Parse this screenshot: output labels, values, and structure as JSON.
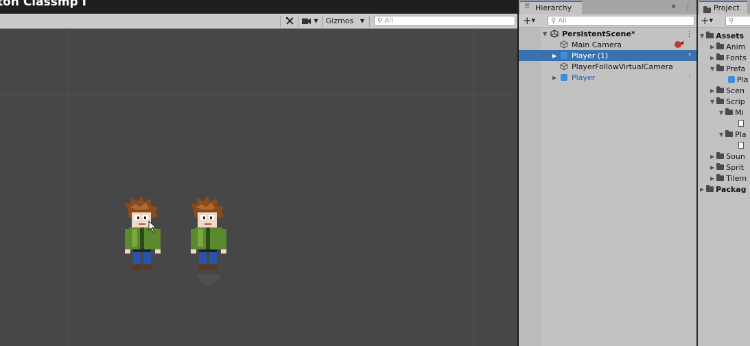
{
  "window": {
    "title": "ton Classmp I"
  },
  "scene_toolbar": {
    "tools_icon": "crossed-tools-icon",
    "camera_icon": "video-camera-icon",
    "gizmos_label": "Gizmos",
    "search_placeholder": "All"
  },
  "hierarchy": {
    "tab_label": "Hierarchy",
    "add_label": "+",
    "search_placeholder": "All",
    "scene_name": "PersistentScene*",
    "items": [
      {
        "label": "Main Camera",
        "icon": "gameobject-outline-icon",
        "selected": false,
        "prefab": false
      },
      {
        "label": "Player (1)",
        "icon": "prefab-cube-icon",
        "selected": true,
        "prefab": true
      },
      {
        "label": "PlayerFollowVirtualCamera",
        "icon": "gameobject-outline-icon",
        "selected": false,
        "prefab": false
      },
      {
        "label": "Player",
        "icon": "prefab-cube-icon",
        "selected": false,
        "prefab": true
      }
    ]
  },
  "project": {
    "tab_label": "Project",
    "add_label": "+",
    "tree": [
      {
        "label": "Assets",
        "bold": true
      },
      {
        "label": "Anim"
      },
      {
        "label": "Fonts"
      },
      {
        "label": "Prefa"
      },
      {
        "label": "Pla"
      },
      {
        "label": "Scen"
      },
      {
        "label": "Scrip"
      },
      {
        "label": "Mi"
      },
      {
        "label": "Pla"
      },
      {
        "label": "Soun"
      },
      {
        "label": "Sprit"
      },
      {
        "label": "Tilem"
      },
      {
        "label": "Packag",
        "bold": true
      }
    ]
  },
  "colors": {
    "scene_bg": "#474747",
    "panel_bg": "#c2c2c2",
    "selection": "#3a72b0",
    "prefab_blue": "#1d5fb0"
  }
}
